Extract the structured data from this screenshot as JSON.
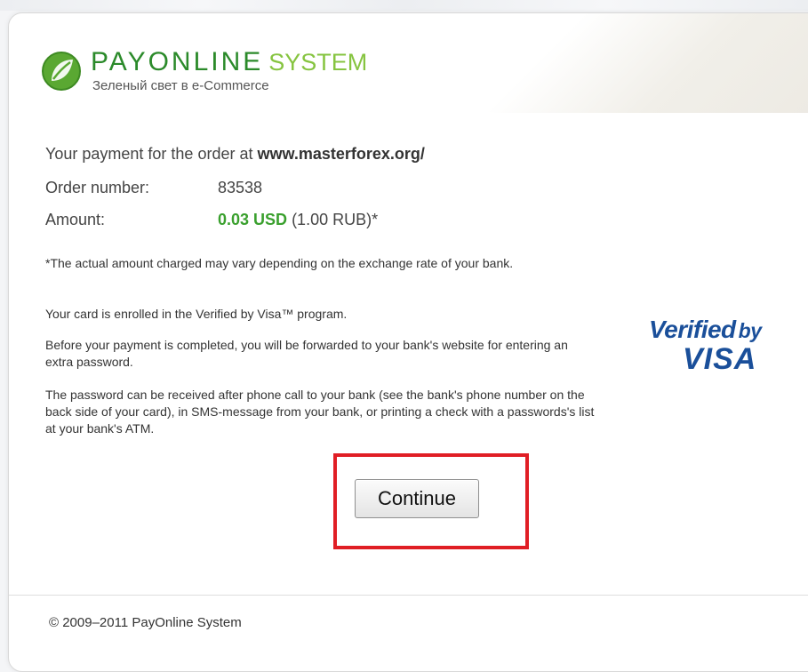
{
  "logo": {
    "brand": "PAYONLINE",
    "system": "SYSTEM",
    "tagline": "Зеленый свет в e-Commerce"
  },
  "order": {
    "intro": "Your payment for the order at",
    "site": "www.masterforex.org/",
    "number_label": "Order number:",
    "number_value": "83538",
    "amount_label": "Amount:",
    "amount_usd": "0.03 USD",
    "amount_rub": "(1.00 RUB)*"
  },
  "notes": {
    "exchange": "*The actual amount charged may vary depending on the exchange rate of your bank.",
    "enrolled": "Your card is enrolled in the Verified by Visa™ program.",
    "forwarded": "Before your payment is completed, you will be forwarded to your bank's website for entering an extra password.",
    "password_info": "The password can be received after phone call to your bank (see the bank's phone number on the back side of your card), in SMS-message from your bank, or printing a check with a passwords's list at your bank's ATM."
  },
  "verified_by_visa": {
    "line1": "Verified",
    "by": "by",
    "line2": "VISA"
  },
  "actions": {
    "continue_label": "Continue"
  },
  "footer": {
    "copyright": "© 2009–2011 PayOnline System"
  },
  "colors": {
    "brand_green": "#2b8a2a",
    "system_green": "#86c440",
    "amount_green": "#3aa02e",
    "visa_blue": "#1a4f9a",
    "highlight_red": "#e01e25"
  }
}
